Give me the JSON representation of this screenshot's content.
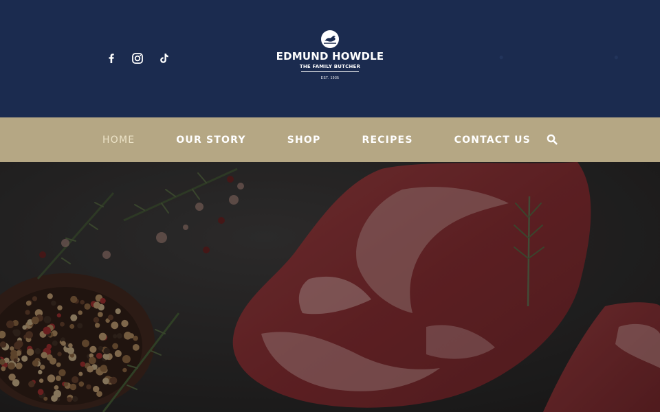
{
  "social": {
    "items": [
      {
        "name": "facebook-icon"
      },
      {
        "name": "instagram-icon"
      },
      {
        "name": "tiktok-icon"
      }
    ]
  },
  "brand": {
    "name": "EDMUND HOWDLE",
    "tagline": "THE FAMILY BUTCHER",
    "established": "EST. 1935"
  },
  "nav": {
    "items": [
      {
        "label": "HOME",
        "active": true
      },
      {
        "label": "OUR STORY",
        "active": false
      },
      {
        "label": "SHOP",
        "active": false
      },
      {
        "label": "RECIPES",
        "active": false
      },
      {
        "label": "CONTACT US",
        "active": false
      }
    ],
    "search_icon": "search-icon"
  },
  "colors": {
    "header_bg": "#1b2b4f",
    "nav_bg": "#b5a784",
    "nav_text": "#ffffff",
    "nav_active_text": "#ece3c8"
  }
}
